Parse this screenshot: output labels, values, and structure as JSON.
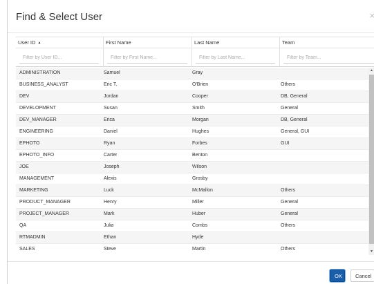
{
  "dialog": {
    "title": "Find & Select User",
    "close_label": "×"
  },
  "columns": [
    {
      "label": "User ID",
      "sorted": "ascending",
      "sort_glyph": "▲",
      "filter_placeholder": "Filter by User ID..."
    },
    {
      "label": "First Name",
      "filter_placeholder": "Filter by First Name..."
    },
    {
      "label": "Last Name",
      "filter_placeholder": "Filter by Last Name..."
    },
    {
      "label": "Team",
      "filter_placeholder": "Filter by Team..."
    }
  ],
  "rows": [
    {
      "user_id": "ADMINISTRATION",
      "first_name": "Samuel",
      "last_name": "Gray",
      "team": ""
    },
    {
      "user_id": "BUSINESS_ANALYST",
      "first_name": "Eric T.",
      "last_name": "O'Brien",
      "team": "Others"
    },
    {
      "user_id": "DEV",
      "first_name": "Jordan",
      "last_name": "Cooper",
      "team": "DB, General"
    },
    {
      "user_id": "DEVELOPMENT",
      "first_name": "Susan",
      "last_name": "Smith",
      "team": "General"
    },
    {
      "user_id": "DEV_MANAGER",
      "first_name": "Erica",
      "last_name": "Morgan",
      "team": "DB, General"
    },
    {
      "user_id": "ENGINEERING",
      "first_name": "Daniel",
      "last_name": "Hughes",
      "team": "General, GUI"
    },
    {
      "user_id": "EPHOTO",
      "first_name": "Ryan",
      "last_name": "Forbes",
      "team": "GUI"
    },
    {
      "user_id": "EPHOTO_INFO",
      "first_name": "Carter",
      "last_name": "Benton",
      "team": ""
    },
    {
      "user_id": "JOE",
      "first_name": "Joseph",
      "last_name": "Wilson",
      "team": ""
    },
    {
      "user_id": "MANAGEMENT",
      "first_name": "Alexis",
      "last_name": "Grosby",
      "team": ""
    },
    {
      "user_id": "MARKETING",
      "first_name": "Luck",
      "last_name": "McMallon",
      "team": "Others"
    },
    {
      "user_id": "PRODUCT_MANAGER",
      "first_name": "Henry",
      "last_name": "Miller",
      "team": "General"
    },
    {
      "user_id": "PROJECT_MANAGER",
      "first_name": "Mark",
      "last_name": "Huber",
      "team": "General"
    },
    {
      "user_id": "QA",
      "first_name": "Julia",
      "last_name": "Combs",
      "team": "Others"
    },
    {
      "user_id": "RTMADMIN",
      "first_name": "Ethan",
      "last_name": "Hyde",
      "team": ""
    },
    {
      "user_id": "SALES",
      "first_name": "Steve",
      "last_name": "Martin",
      "team": "Others"
    }
  ],
  "scrollbar": {
    "up_icon": "▲",
    "down_icon": "▼"
  },
  "footer": {
    "ok_label": "OK",
    "cancel_label": "Cancel"
  },
  "colors": {
    "primary_button": "#1a5da8",
    "row_alt": "#f5f5f5"
  }
}
